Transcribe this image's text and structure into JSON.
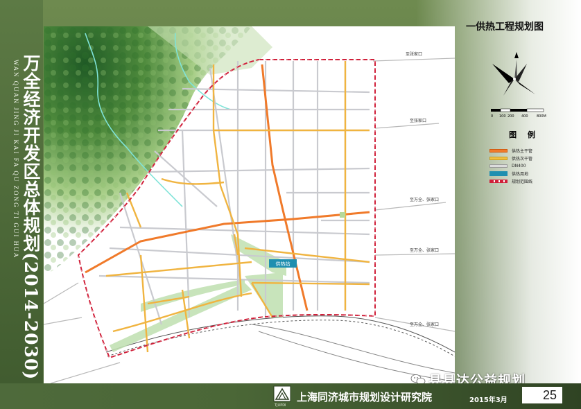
{
  "slide": {
    "vertical_title": "万全经济开发区总体规划(2014-2030)",
    "vertical_pinyin": "WAN QUAN JING JI KAI FA QU ZONG TI GUI HUA",
    "map_title": "一供热工程规划图",
    "legend_title": "图 例",
    "legend": [
      {
        "label": "供热主干管",
        "color": "#f07a2a"
      },
      {
        "label": "供热次干管",
        "color": "#f0c040"
      },
      {
        "label": "DN400",
        "color": "#c8c8c8"
      },
      {
        "label": "供热用地",
        "color": "#1f8fb0"
      },
      {
        "label": "规划范围线",
        "color": "#d0203a"
      }
    ],
    "scale_labels": [
      "0",
      "100",
      "200",
      "400",
      "800M"
    ],
    "facility_label": "供热站",
    "destination_labels": [
      "至张家口",
      "至张家口",
      "至万全、张家口",
      "至万全、张家口",
      "至万全、张家口"
    ],
    "footer": {
      "logo_text": "TJUPDI",
      "org": "上海同济城市规划设计研究院",
      "date": "2015年3月",
      "page": "25"
    },
    "watermark": "县县达公益规划"
  }
}
